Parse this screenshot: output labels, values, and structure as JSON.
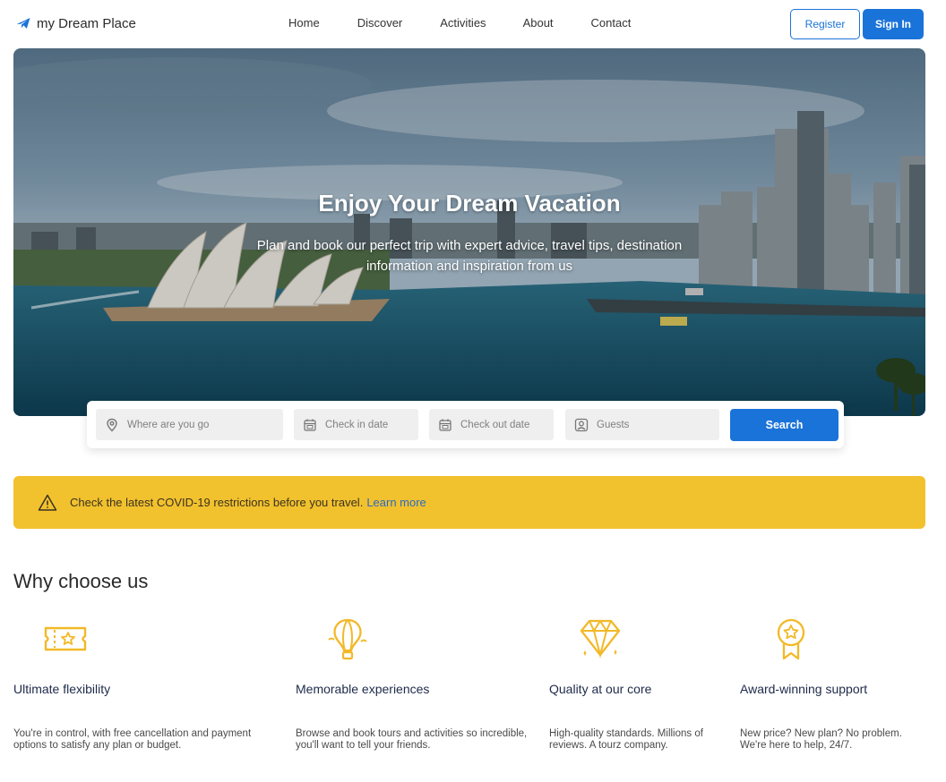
{
  "nav": {
    "brand": "my Dream Place",
    "brand_icon": "airplane-icon",
    "links": [
      "Home",
      "Discover",
      "Activities",
      "About",
      "Contact"
    ],
    "register_label": "Register",
    "signin_label": "Sign In"
  },
  "hero": {
    "title": "Enjoy Your Dream Vacation",
    "subtitle": "Plan and book our perfect trip with expert advice, travel tips, destination information and inspiration from us"
  },
  "search": {
    "where_placeholder": "Where are you go",
    "checkin_placeholder": "Check in date",
    "checkout_placeholder": "Check out date",
    "guests_placeholder": "Guests",
    "button_label": "Search"
  },
  "alert": {
    "text": "Check the latest COVID-19 restrictions before you travel.",
    "link": "Learn more"
  },
  "why": {
    "title": "Why choose us",
    "features": [
      {
        "icon": "ticket-icon",
        "title": "Ultimate flexibility",
        "desc": "You're in control, with free cancellation and payment options to satisfy any plan or budget."
      },
      {
        "icon": "hot-air-balloon-icon",
        "title": "Memorable experiences",
        "desc": "Browse and book tours and activities so incredible, you'll want to tell your friends."
      },
      {
        "icon": "diamond-icon",
        "title": "Quality at our core",
        "desc": "High-quality standards. Millions of reviews. A tourz company."
      },
      {
        "icon": "award-medal-icon",
        "title": "Award-winning support",
        "desc": "New price? New plan? No problem. We're here to help, 24/7."
      }
    ]
  },
  "colors": {
    "primary": "#1a73d9",
    "alert_bg": "#f2c12e",
    "icon_accent": "#f2b928"
  }
}
